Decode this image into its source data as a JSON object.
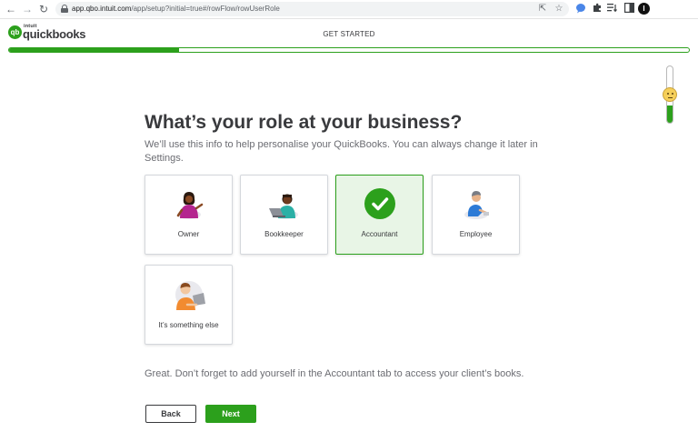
{
  "browser": {
    "url_host": "app.qbo.intuit.com",
    "url_path": "/app/setup?initial=true#/rowFlow/rowUserRole",
    "profile_initial": "I"
  },
  "header": {
    "logo_small": "intuit",
    "logo_brand": "quickbooks",
    "step_title": "GET STARTED",
    "progress_fraction": 0.25
  },
  "mood_slider": {
    "level_fraction": 0.3
  },
  "main": {
    "title": "What’s your role at your business?",
    "subtitle": "We’ll use this info to help personalise your QuickBooks. You can always change it later in Settings.",
    "roles": [
      {
        "label": "Owner",
        "selected": false
      },
      {
        "label": "Bookkeeper",
        "selected": false
      },
      {
        "label": "Accountant",
        "selected": true
      },
      {
        "label": "Employee",
        "selected": false
      },
      {
        "label": "It’s something else",
        "selected": false
      }
    ],
    "note": "Great. Don’t forget to add yourself in the Accountant tab to access your client’s books."
  },
  "buttons": {
    "back": "Back",
    "next": "Next"
  },
  "colors": {
    "brand_green": "#2ca01c",
    "selected_bg": "#e8f5e6",
    "text_dark": "#393a3d",
    "text_muted": "#6b6c72"
  }
}
